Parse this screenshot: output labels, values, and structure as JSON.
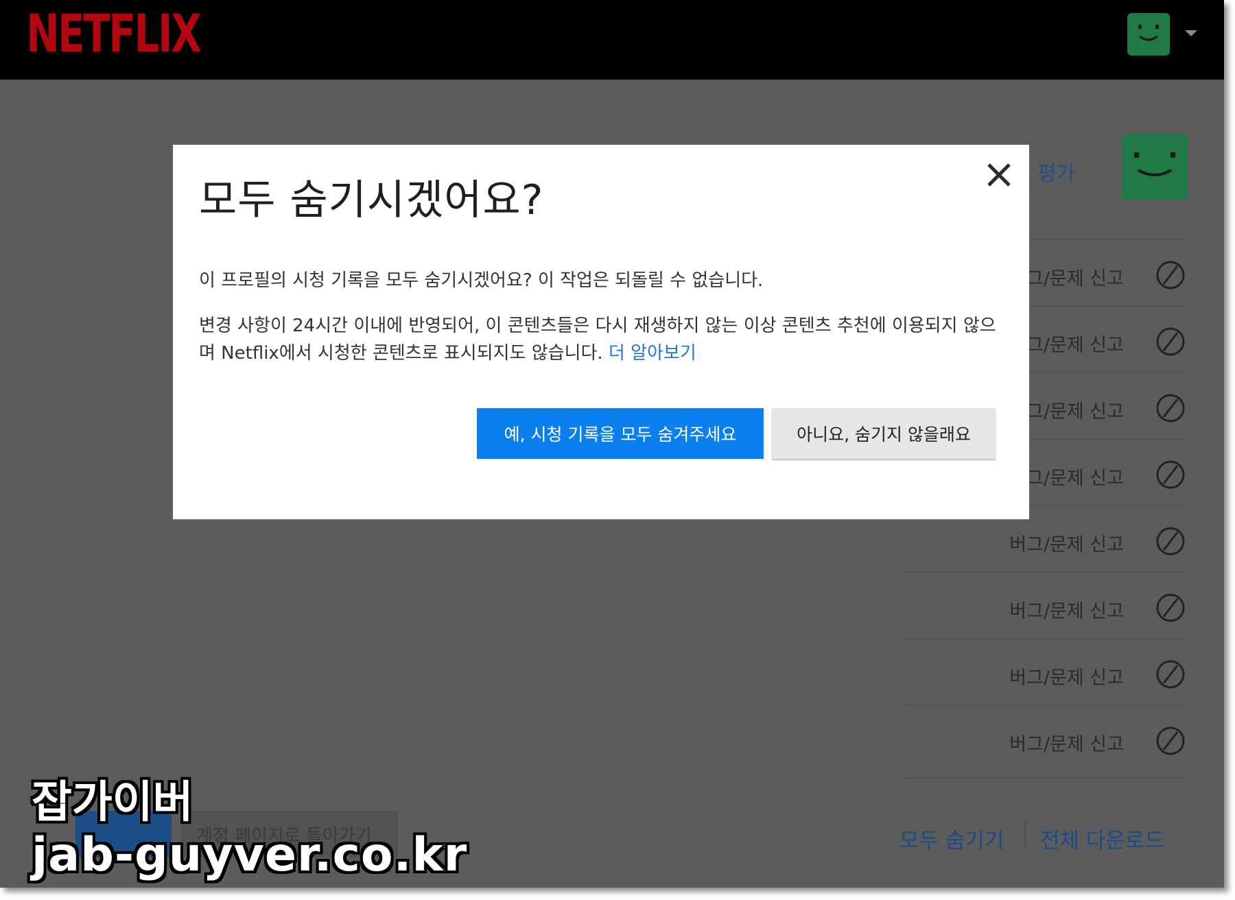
{
  "brand": {
    "logo_text": "NETFLIX",
    "logo_color": "#b20710"
  },
  "header": {
    "profile_avatar": "smiley-face-icon",
    "menu_caret": "caret-down-icon"
  },
  "background": {
    "rate_label": "평가",
    "rows": [
      {
        "label": "버그/문제 신고"
      },
      {
        "label": "버그/문제 신고"
      },
      {
        "label": "버그/문제 신고"
      },
      {
        "label": "버그/문제 신고"
      },
      {
        "label": "버그/문제 신고"
      },
      {
        "label": "버그/문제 신고"
      },
      {
        "label": "버그/문제 신고"
      },
      {
        "label": "버그/문제 신고"
      }
    ],
    "row_icon": "hide-ban-icon",
    "hide_all": "모두 숨기기",
    "download_all": "전체 다운로드",
    "back_to_account": "계정 페이지로 돌아가기"
  },
  "modal": {
    "title": "모두 숨기시겠어요?",
    "paragraph1": "이 프로필의 시청 기록을 모두 숨기시겠어요? 이 작업은 되돌릴 수 없습니다.",
    "paragraph2": "변경 사항이 24시간 이내에 반영되어, 이 콘텐츠들은 다시 재생하지 않는 이상 콘텐츠 추천에 이용되지 않으며 Netflix에서 시청한 콘텐츠로 표시되지도 않습니다.",
    "learn_more": "더 알아보기",
    "confirm_label": "예, 시청 기록을 모두 숨겨주세요",
    "cancel_label": "아니요, 숨기지 않을래요",
    "close_icon": "close-icon"
  },
  "colors": {
    "primary_button": "#0a80f0",
    "link": "#1d77de",
    "avatar": "#217a46"
  },
  "watermark": {
    "title": "잡가이버",
    "url": "jab-guyver.co.kr"
  }
}
